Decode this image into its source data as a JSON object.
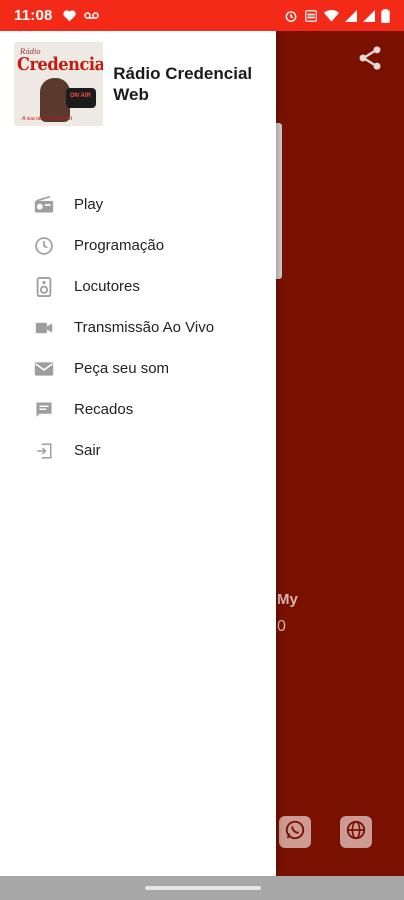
{
  "status_bar": {
    "time": "11:08",
    "left_icons": [
      "heart-icon",
      "voicemail-icon"
    ],
    "right_icons": [
      "alarm-icon",
      "volte-icon",
      "wifi-icon",
      "signal-icon",
      "signal-icon",
      "battery-icon"
    ]
  },
  "drawer": {
    "app_title": "Rádio Credencial Web",
    "logo": {
      "top_text": "Rádio",
      "main_text": "Credencial",
      "mic_text": "ON AIR",
      "foot_text": "A sua rádio na internet"
    },
    "menu": [
      {
        "label": "Play",
        "icon": "radio-icon"
      },
      {
        "label": "Programação",
        "icon": "clock-icon"
      },
      {
        "label": "Locutores",
        "icon": "speaker-icon"
      },
      {
        "label": "Transmissão Ao Vivo",
        "icon": "video-camera-icon"
      },
      {
        "label": "Peça seu som",
        "icon": "mail-icon"
      },
      {
        "label": "Recados",
        "icon": "message-icon"
      },
      {
        "label": "Sair",
        "icon": "exit-icon"
      }
    ]
  },
  "background": {
    "text_1": "My",
    "text_2": "0",
    "buttons": [
      "whatsapp-icon",
      "globe-icon"
    ]
  },
  "colors": {
    "status_bar": "#f32a18",
    "background": "#7a1100",
    "drawer": "#ffffff",
    "menu_icon": "#9e9e9e",
    "nav_bar": "#a7a7a7"
  }
}
